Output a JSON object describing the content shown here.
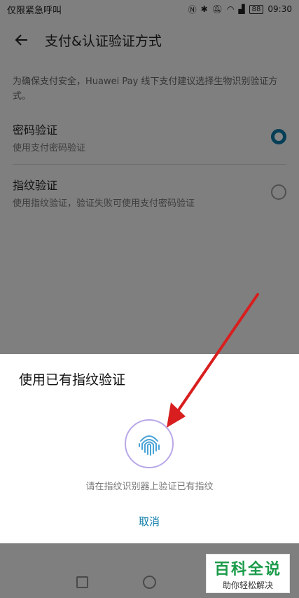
{
  "status": {
    "left_text": "仅限紧急呼叫",
    "time": "09:30",
    "battery": "88"
  },
  "appbar": {
    "title": "支付&认证验证方式"
  },
  "description": "为确保支付安全，Huawei Pay 线下支付建议选择生物识别验证方式。",
  "options": [
    {
      "title": "密码验证",
      "subtitle": "使用支付密码验证",
      "selected": true
    },
    {
      "title": "指纹验证",
      "subtitle": "使用指纹验证，验证失败可使用支付密码验证",
      "selected": false
    }
  ],
  "sheet": {
    "title": "使用已有指纹验证",
    "hint": "请在指纹识别器上验证已有指纹",
    "cancel": "取消"
  },
  "watermark": {
    "big": "百科全说",
    "small": "助你轻松解决"
  },
  "colors": {
    "accent": "#0a7aa8",
    "arrow": "#d81e1e",
    "watermark_green": "#1b9b4a"
  }
}
